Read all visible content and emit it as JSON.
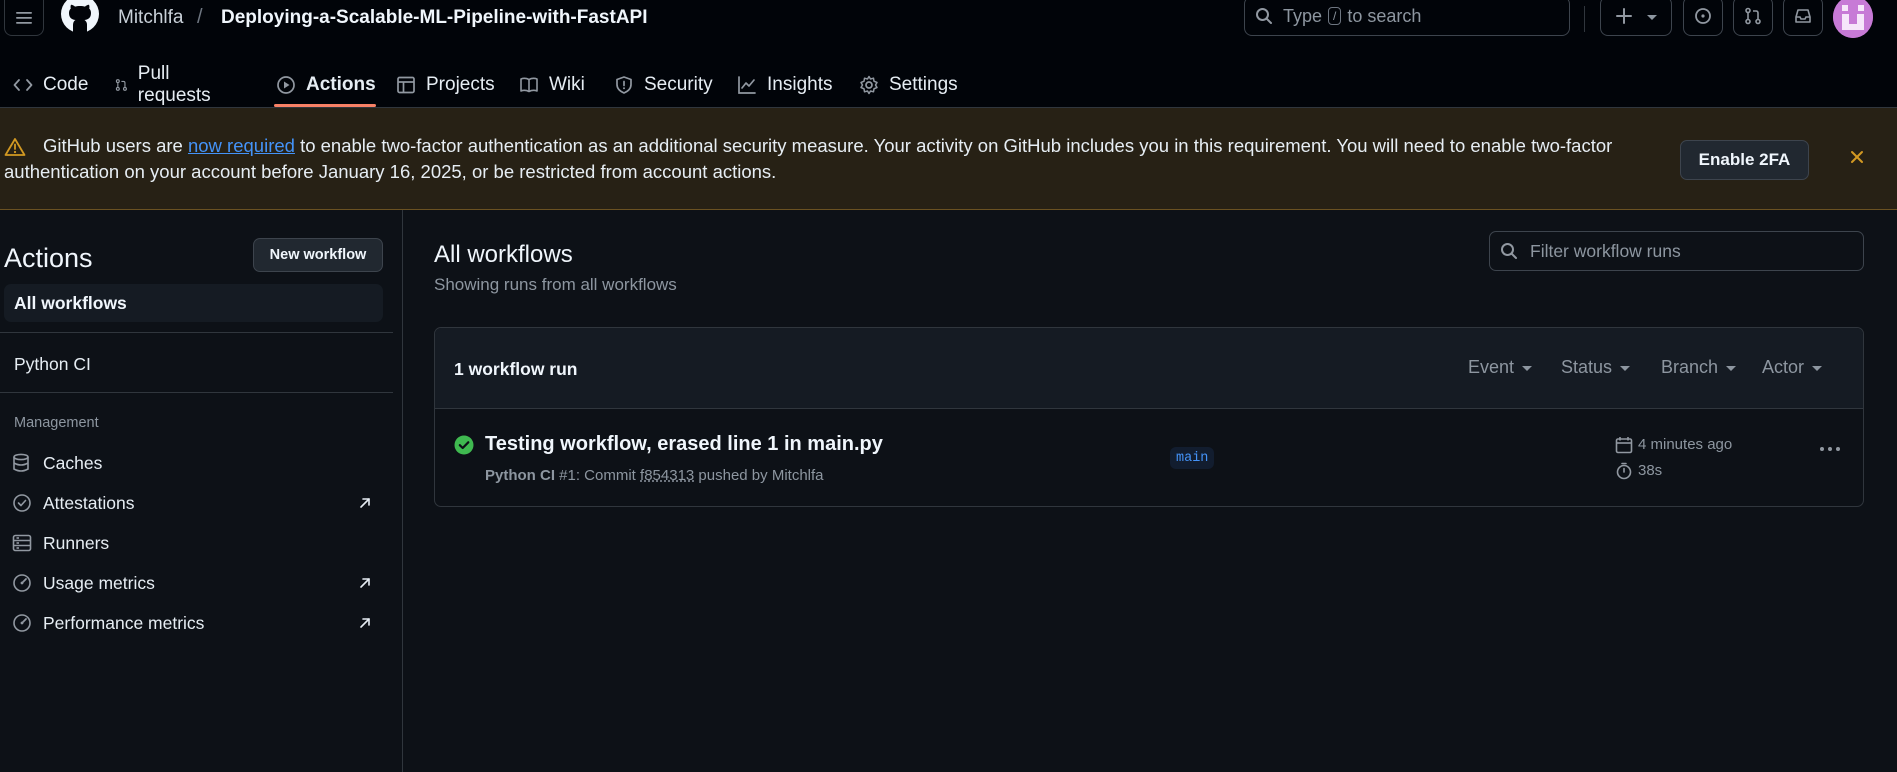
{
  "header": {
    "owner": "Mitchlfa",
    "separator": "/",
    "repo": "Deploying-a-Scalable-ML-Pipeline-with-FastAPI",
    "search": {
      "prefix": "Type",
      "key": "/",
      "suffix": "to search"
    }
  },
  "repo_nav": {
    "tabs": [
      {
        "label": "Code",
        "icon": "code-icon"
      },
      {
        "label": "Pull requests",
        "icon": "git-pull-request-icon"
      },
      {
        "label": "Actions",
        "icon": "play-icon",
        "active": true
      },
      {
        "label": "Projects",
        "icon": "table-icon"
      },
      {
        "label": "Wiki",
        "icon": "book-icon"
      },
      {
        "label": "Security",
        "icon": "shield-icon"
      },
      {
        "label": "Insights",
        "icon": "graph-icon"
      },
      {
        "label": "Settings",
        "icon": "gear-icon"
      }
    ]
  },
  "banner": {
    "text_before": "GitHub users are ",
    "link": "now required",
    "text_after": " to enable two-factor authentication as an additional security measure. Your activity on GitHub includes you in this requirement. You will need to enable two-factor authentication on your account before January 16, 2025, or be restricted from account actions.",
    "button": "Enable 2FA"
  },
  "sidebar": {
    "title": "Actions",
    "new_workflow": "New workflow",
    "all_workflows": "All workflows",
    "workflows": [
      "Python CI"
    ],
    "management_heading": "Management",
    "management": [
      {
        "label": "Caches",
        "icon": "database-icon",
        "external": false
      },
      {
        "label": "Attestations",
        "icon": "verified-icon",
        "external": true
      },
      {
        "label": "Runners",
        "icon": "server-icon",
        "external": false
      },
      {
        "label": "Usage metrics",
        "icon": "meter-icon",
        "external": true
      },
      {
        "label": "Performance metrics",
        "icon": "meter-icon",
        "external": true
      }
    ]
  },
  "main": {
    "title": "All workflows",
    "subtitle": "Showing runs from all workflows",
    "filter_placeholder": "Filter workflow runs",
    "runs_count": "1 workflow run",
    "filters": [
      "Event",
      "Status",
      "Branch",
      "Actor"
    ],
    "run": {
      "title": "Testing workflow, erased line 1 in main.py",
      "workflow": "Python CI",
      "meta_mid": " #1: Commit ",
      "sha": "f854313",
      "meta_end": " pushed by Mitchlfa",
      "branch": "main",
      "time_ago": "4 minutes ago",
      "duration": "38s",
      "status": "success"
    }
  },
  "colors": {
    "background": "#0d1117",
    "header": "#010409",
    "accent_underline": "#f78166",
    "link": "#4493f8",
    "success": "#3fb950",
    "warning": "#d29922"
  }
}
